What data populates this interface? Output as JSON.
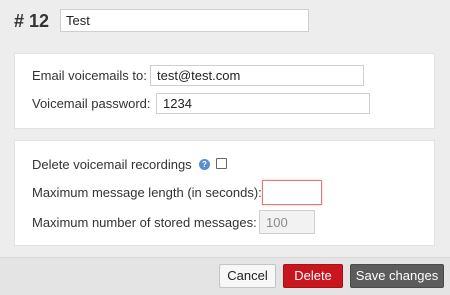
{
  "header": {
    "number": "# 12",
    "name_value": "Test"
  },
  "email_section": {
    "email_label": "Email voicemails to:",
    "email_value": "test@test.com",
    "password_label": "Voicemail password:",
    "password_value": "1234"
  },
  "options_section": {
    "delete_label": "Delete voicemail recordings",
    "delete_checked": false,
    "help_icon": "?",
    "max_length_label": "Maximum message length (in seconds):",
    "max_length_value": "",
    "max_stored_label": "Maximum number of stored messages:",
    "max_stored_value": "100"
  },
  "footer": {
    "cancel_label": "Cancel",
    "delete_label": "Delete",
    "save_label": "Save changes"
  },
  "colors": {
    "delete_button": "#c9151d",
    "save_button": "#5c5c5c",
    "error_border": "#e07a7a"
  }
}
